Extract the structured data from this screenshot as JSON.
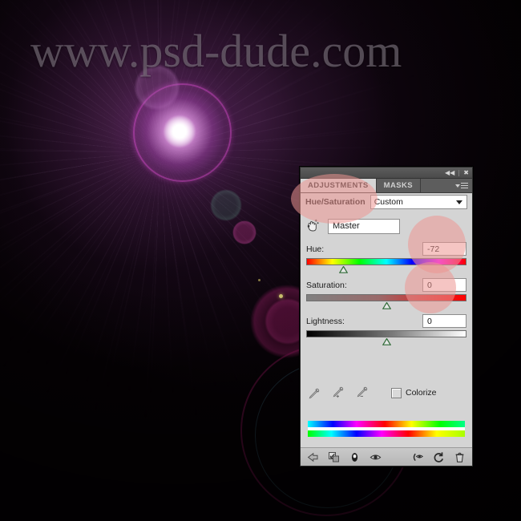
{
  "background": {
    "watermark_text": "www.psd-dude.com",
    "description": "purple lens flare on black background"
  },
  "panel": {
    "topbar": {
      "collapse_icon": "double-left-chevron-icon",
      "close_icon": "close-icon"
    },
    "tabs": [
      {
        "label": "ADJUSTMENTS",
        "active": true
      },
      {
        "label": "MASKS",
        "active": false
      }
    ],
    "menu_icon": "panel-menu-icon",
    "preset": {
      "title": "Hue/Saturation",
      "selected": "Custom"
    },
    "channel": {
      "tool_icon": "on-image-adjust-hand-icon",
      "selected": "Master"
    },
    "sliders": [
      {
        "label": "Hue:",
        "value": "-72",
        "thumb_percent": 23,
        "track": "hue"
      },
      {
        "label": "Saturation:",
        "value": "0",
        "thumb_percent": 50,
        "track": "saturation"
      },
      {
        "label": "Lightness:",
        "value": "0",
        "thumb_percent": 50,
        "track": "lightness"
      }
    ],
    "tools": {
      "eyedropper": "eyedropper-icon",
      "eyedropper_add": "eyedropper-add-icon",
      "eyedropper_subtract": "eyedropper-subtract-icon",
      "colorize_label": "Colorize",
      "colorize_checked": false
    },
    "bottom_bar": {
      "buttons": [
        "clip-to-layer-icon",
        "previous-state-icon",
        "toggle-layer-visibility-icon",
        "preview-eye-icon",
        "reset-eye-icon",
        "reset-icon",
        "delete-icon"
      ]
    },
    "colors": {
      "panel_background": "#d4d4d4",
      "tab_bar": "#5d5d5d",
      "highlight_annotation": "#ec9691",
      "flare_purple": "#a040b0"
    }
  }
}
